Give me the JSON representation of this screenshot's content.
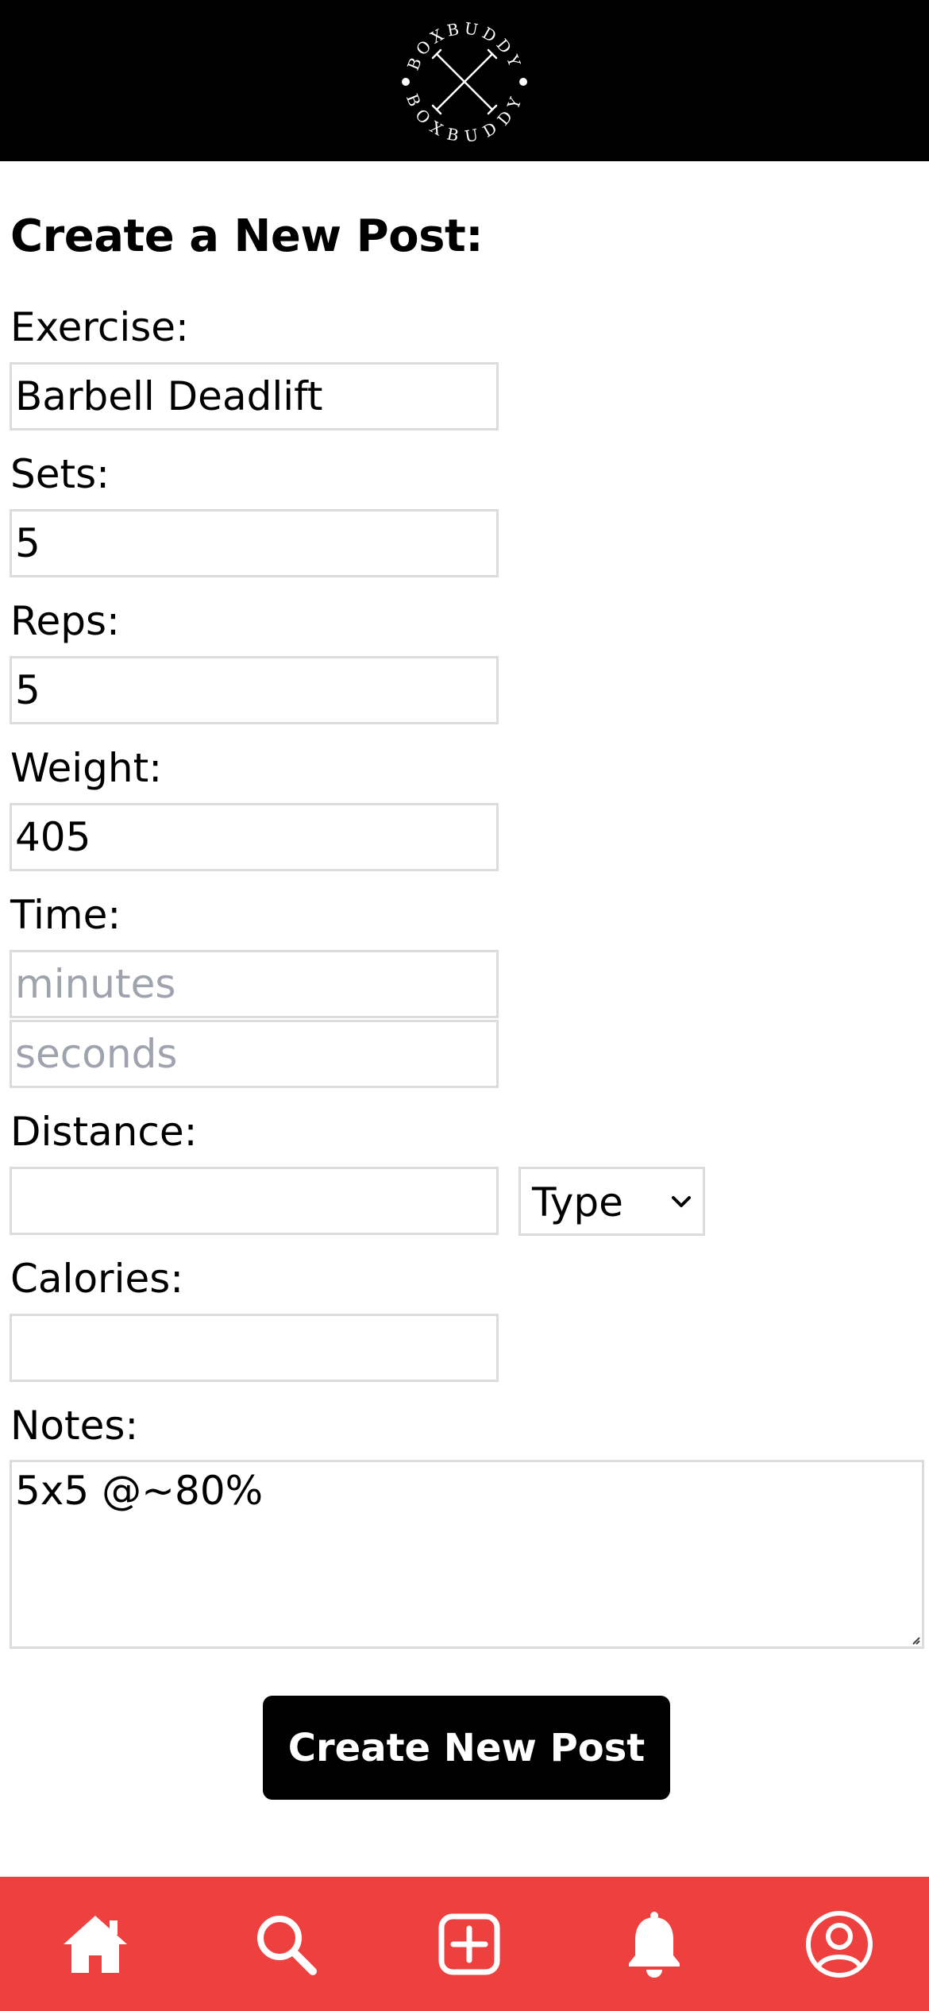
{
  "app": {
    "logo_text_top": "BOXBUDDY",
    "logo_text_bottom": "BOXBUDDY"
  },
  "form": {
    "title": "Create a New Post:",
    "exercise": {
      "label": "Exercise:",
      "value": "Barbell Deadlift"
    },
    "sets": {
      "label": "Sets:",
      "value": "5"
    },
    "reps": {
      "label": "Reps:",
      "value": "5"
    },
    "weight": {
      "label": "Weight:",
      "value": "405"
    },
    "time": {
      "label": "Time:",
      "minutes_placeholder": "minutes",
      "seconds_placeholder": "seconds"
    },
    "distance": {
      "label": "Distance:",
      "value": "",
      "type_selected": "Type"
    },
    "calories": {
      "label": "Calories:",
      "value": ""
    },
    "notes": {
      "label": "Notes:",
      "value": "5x5 @~80%"
    },
    "submit_label": "Create New Post"
  },
  "nav": {
    "items": [
      {
        "name": "home",
        "icon": "home-icon"
      },
      {
        "name": "search",
        "icon": "search-icon"
      },
      {
        "name": "add-post",
        "icon": "plus-square-icon"
      },
      {
        "name": "notifications",
        "icon": "bell-icon"
      },
      {
        "name": "profile",
        "icon": "user-circle-icon"
      }
    ]
  },
  "colors": {
    "header_bg": "#000000",
    "nav_bg": "#ef4040",
    "button_bg": "#000000",
    "placeholder": "#9ea3ad"
  }
}
